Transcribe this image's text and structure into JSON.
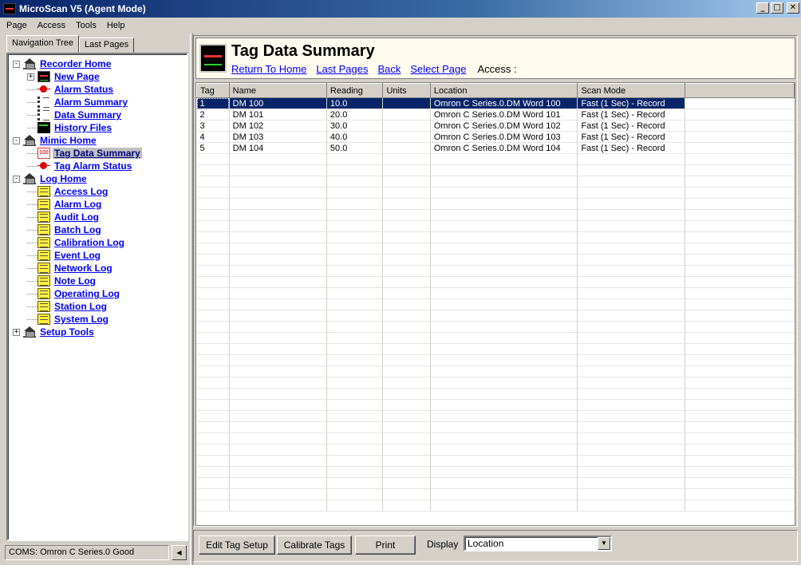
{
  "window": {
    "title": "MicroScan V5 (Agent Mode)"
  },
  "menu": [
    "Page",
    "Access",
    "Tools",
    "Help"
  ],
  "tabs": [
    "Navigation Tree",
    "Last Pages"
  ],
  "tree": [
    {
      "label": "Recorder Home",
      "level": 0,
      "icon": "home-icon",
      "expander": "-"
    },
    {
      "label": "New Page",
      "level": 1,
      "icon": "chart-page-icon",
      "expander": "+"
    },
    {
      "label": "Alarm Status",
      "level": 1,
      "icon": "alarm-icon"
    },
    {
      "label": "Alarm Summary",
      "level": 1,
      "icon": "list-icon"
    },
    {
      "label": "Data Summary",
      "level": 1,
      "icon": "list-icon"
    },
    {
      "label": "History Files",
      "level": 1,
      "icon": "history-icon"
    },
    {
      "label": "Mimic Home",
      "level": 0,
      "icon": "home-icon",
      "expander": "-"
    },
    {
      "label": "Tag Data Summary",
      "level": 1,
      "icon": "numeric-display-icon",
      "selected": true
    },
    {
      "label": "Tag Alarm Status",
      "level": 1,
      "icon": "alarm-icon"
    },
    {
      "label": "Log Home",
      "level": 0,
      "icon": "home-icon",
      "expander": "-"
    },
    {
      "label": "Access Log",
      "level": 1,
      "icon": "log-icon"
    },
    {
      "label": "Alarm Log",
      "level": 1,
      "icon": "log-icon"
    },
    {
      "label": "Audit Log",
      "level": 1,
      "icon": "log-icon"
    },
    {
      "label": "Batch Log",
      "level": 1,
      "icon": "log-icon"
    },
    {
      "label": "Calibration Log",
      "level": 1,
      "icon": "log-icon"
    },
    {
      "label": "Event Log",
      "level": 1,
      "icon": "log-icon"
    },
    {
      "label": "Network Log",
      "level": 1,
      "icon": "log-icon"
    },
    {
      "label": "Note Log",
      "level": 1,
      "icon": "log-icon"
    },
    {
      "label": "Operating Log",
      "level": 1,
      "icon": "log-icon"
    },
    {
      "label": "Station Log",
      "level": 1,
      "icon": "log-icon"
    },
    {
      "label": "System Log",
      "level": 1,
      "icon": "log-icon"
    },
    {
      "label": "Setup Tools",
      "level": 0,
      "icon": "home-icon",
      "expander": "+"
    }
  ],
  "status": {
    "text": "COMS: Omron C Series.0 Good"
  },
  "header": {
    "title": "Tag Data Summary",
    "links": [
      "Return To Home",
      "Last Pages",
      "Back",
      "Select Page"
    ],
    "access_label": "Access :"
  },
  "table": {
    "columns": [
      "Tag",
      "Name",
      "Reading",
      "Units",
      "Location",
      "Scan Mode"
    ],
    "rows": [
      [
        "1",
        "DM 100",
        "10.0",
        "",
        "Omron C Series.0.DM  Word 100",
        "Fast (1 Sec) - Record"
      ],
      [
        "2",
        "DM 101",
        "20.0",
        "",
        "Omron C Series.0.DM  Word 101",
        "Fast (1 Sec) - Record"
      ],
      [
        "3",
        "DM 102",
        "30.0",
        "",
        "Omron C Series.0.DM  Word 102",
        "Fast (1 Sec) - Record"
      ],
      [
        "4",
        "DM 103",
        "40.0",
        "",
        "Omron C Series.0.DM  Word 103",
        "Fast (1 Sec) - Record"
      ],
      [
        "5",
        "DM 104",
        "50.0",
        "",
        "Omron C Series.0.DM  Word 104",
        "Fast (1 Sec) - Record"
      ]
    ],
    "selected_row": 0
  },
  "buttons": {
    "edit": "Edit Tag Setup",
    "calibrate": "Calibrate Tags",
    "print": "Print"
  },
  "display": {
    "label": "Display",
    "value": "Location"
  },
  "colors": {
    "selection": "#0a246a",
    "link": "#0000ff",
    "header_bg": "#fffaee"
  }
}
